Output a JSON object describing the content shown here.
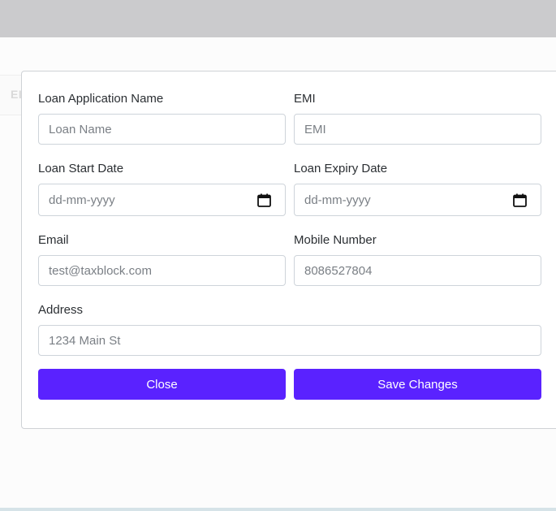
{
  "background": {
    "ghost_text": "EI"
  },
  "form": {
    "loan_name": {
      "label": "Loan Application Name",
      "placeholder": "Loan Name"
    },
    "emi": {
      "label": "EMI",
      "placeholder": "EMI"
    },
    "start_date": {
      "label": "Loan Start Date",
      "placeholder": "dd-mm-yyyy"
    },
    "expiry_date": {
      "label": "Loan Expiry Date",
      "placeholder": "dd-mm-yyyy"
    },
    "email": {
      "label": "Email",
      "placeholder": "test@taxblock.com"
    },
    "mobile": {
      "label": "Mobile Number",
      "placeholder": "8086527804"
    },
    "address": {
      "label": "Address",
      "placeholder": "1234 Main St"
    }
  },
  "actions": {
    "close_label": "Close",
    "save_label": "Save Changes"
  },
  "colors": {
    "primary": "#5a22ff",
    "topbar": "#cbcbcd",
    "border": "#ced4da"
  },
  "icons": {
    "date_picker": "calendar-icon"
  }
}
